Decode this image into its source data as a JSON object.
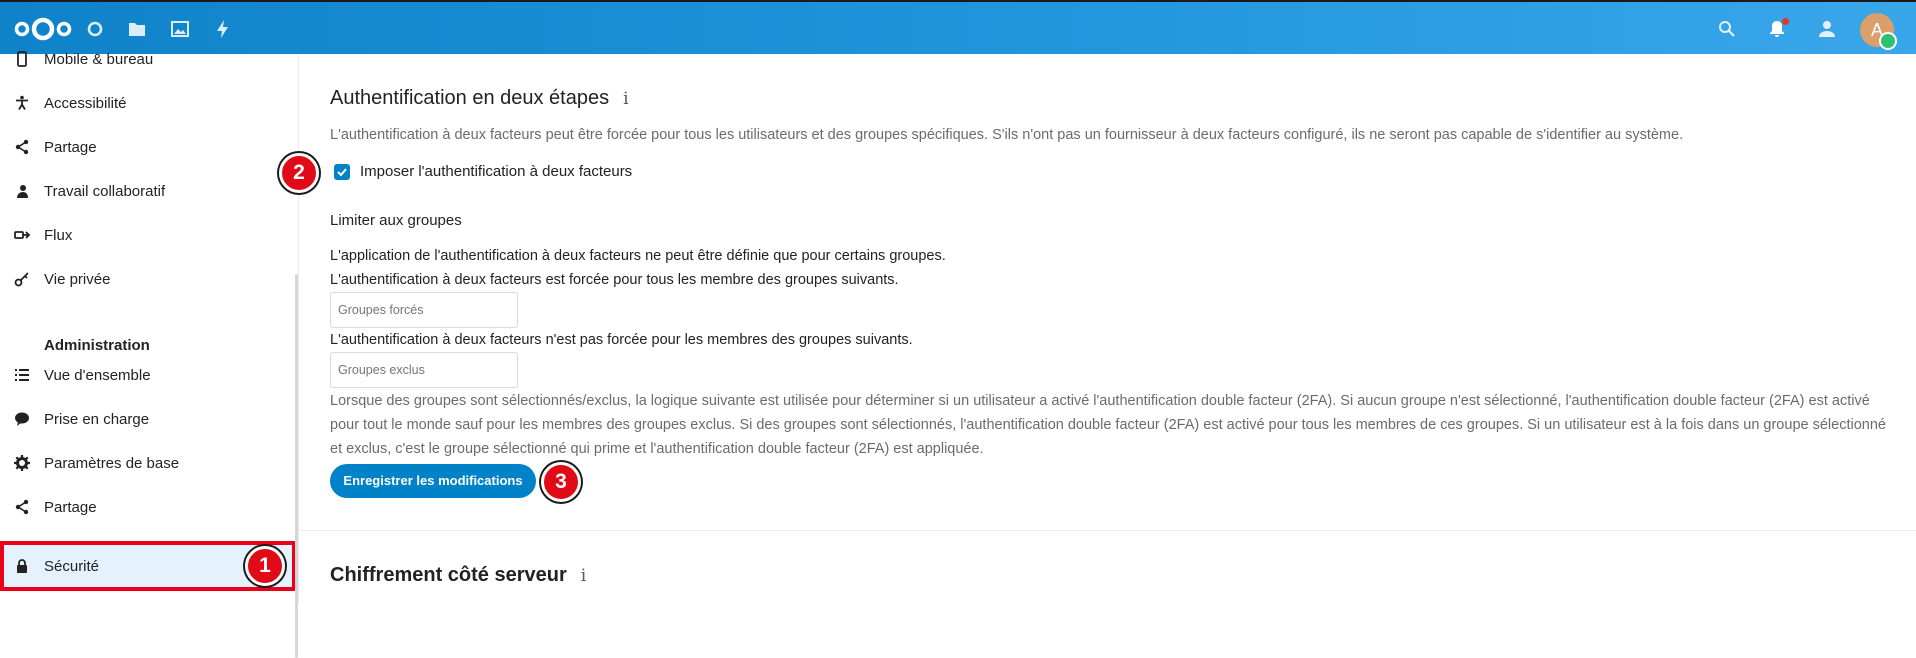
{
  "header": {
    "logo": "nextcloud-logo",
    "apps": [
      "dashboard-icon",
      "files-icon",
      "photos-icon",
      "activity-icon"
    ],
    "right_icons": [
      "search-icon",
      "notifications-icon",
      "contacts-icon"
    ],
    "avatar_letter": "A",
    "colors": {
      "primary": "#0082c9",
      "status_online": "#2fbf71",
      "notification_dot": "#e9322d"
    }
  },
  "sidebar": {
    "personal_items": [
      {
        "label": "Mobile & bureau",
        "icon": "phone-icon"
      },
      {
        "label": "Accessibilité",
        "icon": "accessibility-icon"
      },
      {
        "label": "Partage",
        "icon": "share-icon"
      },
      {
        "label": "Travail collaboratif",
        "icon": "groupware-icon"
      },
      {
        "label": "Flux",
        "icon": "flow-icon"
      },
      {
        "label": "Vie privée",
        "icon": "key-icon"
      }
    ],
    "admin_caption": "Administration",
    "admin_items": [
      {
        "label": "Vue d'ensemble",
        "icon": "list-icon"
      },
      {
        "label": "Prise en charge",
        "icon": "support-icon"
      },
      {
        "label": "Paramètres de base",
        "icon": "gear-icon"
      },
      {
        "label": "Partage",
        "icon": "share-icon"
      },
      {
        "label": "Sécurité",
        "icon": "lock-icon",
        "active": true
      }
    ]
  },
  "twofactor": {
    "title": "Authentification en deux étapes",
    "info_glyph": "i",
    "description": "L'authentification à deux facteurs peut être forcée pour tous les utilisateurs et des groupes spécifiques. S'ils n'ont pas un fournisseur à deux facteurs configuré, ils ne seront pas capable de s'identifier au système.",
    "enforce_label": "Imposer l'authentification à deux facteurs",
    "enforce_checked": true,
    "limit_heading": "Limiter aux groupes",
    "limit_info": "L'application de l'authentification à deux facteurs ne peut être définie que pour certains groupes.",
    "enforced_info": "L'authentification à deux facteurs est forcée pour tous les membre des groupes suivants.",
    "enforced_placeholder": "Groupes forcés",
    "excluded_info": "L'authentification à deux facteurs n'est pas forcée pour les membres des groupes suivants.",
    "excluded_placeholder": "Groupes exclus",
    "logic_description": "Lorsque des groupes sont sélectionnés/exclus, la logique suivante est utilisée pour déterminer si un utilisateur a activé l'authentification double facteur (2FA). Si aucun groupe n'est sélectionné, l'authentification double facteur (2FA) est activé pour tout le monde sauf pour les membres des groupes exclus. Si des groupes sont sélectionnés, l'authentification double facteur (2FA) est activé pour tous les membres de ces groupes. Si un utilisateur est à la fois dans un groupe sélectionné et exclus, c'est le groupe sélectionné qui prime et l'authentification double facteur (2FA) est appliquée.",
    "save_label": "Enregistrer les modifications"
  },
  "encryption": {
    "title": "Chiffrement côté serveur",
    "info_glyph": "i"
  },
  "annotations": {
    "badge_1": "1",
    "badge_2": "2",
    "badge_3": "3",
    "badge_color": "#e10b17"
  }
}
